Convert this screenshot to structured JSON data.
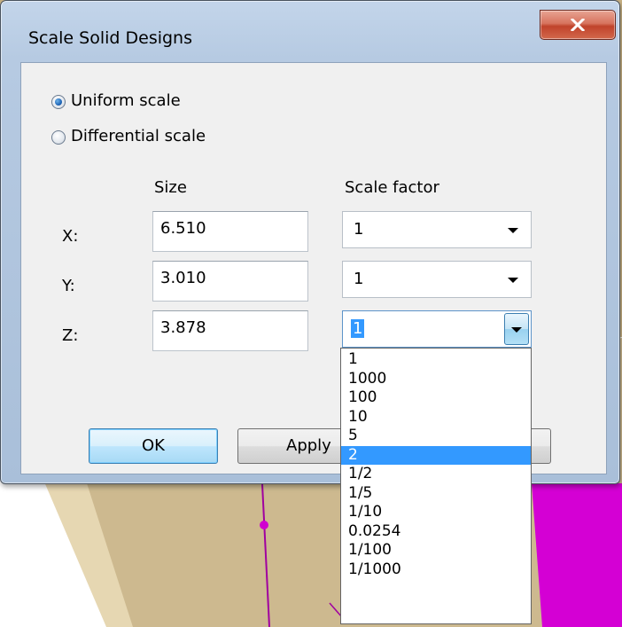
{
  "dialog": {
    "title": "Scale Solid Designs",
    "close_icon": "x-close-icon",
    "scale_mode": {
      "uniform_label": "Uniform scale",
      "differential_label": "Differential scale",
      "selected": "uniform"
    },
    "headers": {
      "size": "Size",
      "scale_factor": "Scale factor"
    },
    "rows": [
      {
        "axis": "X:",
        "size": "6.510",
        "factor": "1"
      },
      {
        "axis": "Y:",
        "size": "3.010",
        "factor": "1"
      },
      {
        "axis": "Z:",
        "size": "3.878",
        "factor": "1"
      }
    ],
    "buttons": {
      "ok": "OK",
      "apply": "Apply"
    }
  },
  "dropdown": {
    "options": [
      "1",
      "1000",
      "100",
      "10",
      "5",
      "2",
      "1/2",
      "1/5",
      "1/10",
      "0.0254",
      "1/100",
      "1/1000"
    ],
    "highlighted": "2"
  },
  "colors": {
    "accent": "#3399ff",
    "wire_magenta": "#cc00cc",
    "solid_tan": "#c9b48a"
  }
}
